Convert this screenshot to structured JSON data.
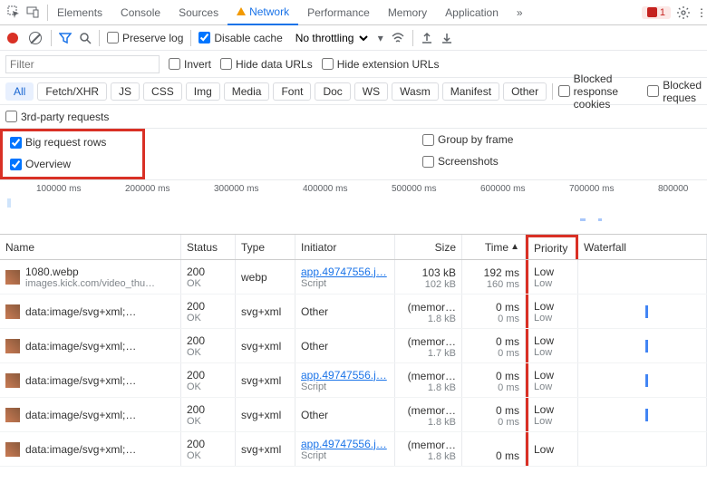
{
  "tabs": [
    "Elements",
    "Console",
    "Sources",
    "Network",
    "Performance",
    "Memory",
    "Application"
  ],
  "activeTab": "Network",
  "errorBadge": "1",
  "toolbar": {
    "preserve": "Preserve log",
    "disableCache": "Disable cache",
    "throttle": "No throttling"
  },
  "filter": {
    "placeholder": "Filter",
    "invert": "Invert",
    "hideData": "Hide data URLs",
    "hideExt": "Hide extension URLs"
  },
  "types": [
    "All",
    "Fetch/XHR",
    "JS",
    "CSS",
    "Img",
    "Media",
    "Font",
    "Doc",
    "WS",
    "Wasm",
    "Manifest",
    "Other"
  ],
  "blockedCookies": "Blocked response cookies",
  "blockedReq": "Blocked reques",
  "thirdParty": "3rd-party requests",
  "opts": {
    "bigRows": "Big request rows",
    "overview": "Overview",
    "groupFrame": "Group by frame",
    "screenshots": "Screenshots"
  },
  "ticks": [
    "100000 ms",
    "200000 ms",
    "300000 ms",
    "400000 ms",
    "500000 ms",
    "600000 ms",
    "700000 ms",
    "800000"
  ],
  "cols": {
    "name": "Name",
    "status": "Status",
    "type": "Type",
    "init": "Initiator",
    "size": "Size",
    "time": "Time",
    "prio": "Priority",
    "wf": "Waterfall"
  },
  "rows": [
    {
      "name": "1080.webp",
      "sub": "images.kick.com/video_thu…",
      "status": "200",
      "statusText": "OK",
      "type": "webp",
      "init": "app.49747556.j…",
      "initSub": "Script",
      "size": "103 kB",
      "size2": "102 kB",
      "time": "192 ms",
      "time2": "160 ms",
      "prio": "Low",
      "prio2": "Low",
      "wf": false
    },
    {
      "name": "data:image/svg+xml;…",
      "sub": "",
      "status": "200",
      "statusText": "OK",
      "type": "svg+xml",
      "init": "Other",
      "initSub": "",
      "size": "(memor…",
      "size2": "1.8 kB",
      "time": "0 ms",
      "time2": "0 ms",
      "prio": "Low",
      "prio2": "Low",
      "wf": true
    },
    {
      "name": "data:image/svg+xml;…",
      "sub": "",
      "status": "200",
      "statusText": "OK",
      "type": "svg+xml",
      "init": "Other",
      "initSub": "",
      "size": "(memor…",
      "size2": "1.7 kB",
      "time": "0 ms",
      "time2": "0 ms",
      "prio": "Low",
      "prio2": "Low",
      "wf": true
    },
    {
      "name": "data:image/svg+xml;…",
      "sub": "",
      "status": "200",
      "statusText": "OK",
      "type": "svg+xml",
      "init": "app.49747556.j…",
      "initSub": "Script",
      "size": "(memor…",
      "size2": "1.8 kB",
      "time": "0 ms",
      "time2": "0 ms",
      "prio": "Low",
      "prio2": "Low",
      "wf": true
    },
    {
      "name": "data:image/svg+xml;…",
      "sub": "",
      "status": "200",
      "statusText": "OK",
      "type": "svg+xml",
      "init": "Other",
      "initSub": "",
      "size": "(memor…",
      "size2": "1.8 kB",
      "time": "0 ms",
      "time2": "0 ms",
      "prio": "Low",
      "prio2": "Low",
      "wf": true
    },
    {
      "name": "data:image/svg+xml;…",
      "sub": "",
      "status": "200",
      "statusText": "OK",
      "type": "svg+xml",
      "init": "app.49747556.j…",
      "initSub": "Script",
      "size": "(memor…",
      "size2": "1.8 kB",
      "time": "0 ms",
      "time2": "",
      "prio": "Low",
      "prio2": "",
      "wf": false
    }
  ]
}
